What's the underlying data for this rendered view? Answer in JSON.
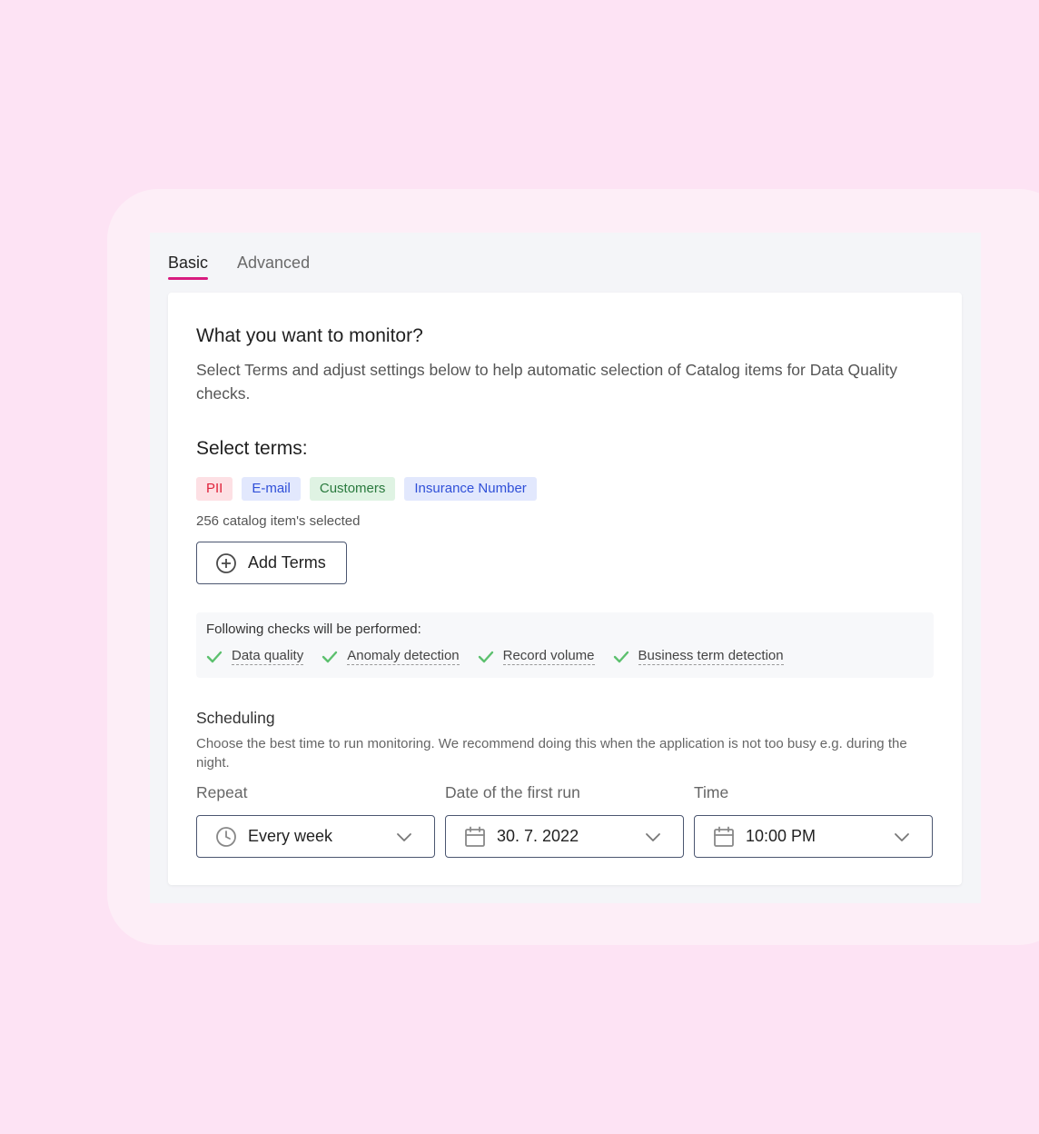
{
  "tabs": [
    {
      "label": "Basic",
      "active": true
    },
    {
      "label": "Advanced",
      "active": false
    }
  ],
  "monitor": {
    "title": "What you want to monitor?",
    "description": "Select Terms and adjust settings below to help automatic selection of Catalog items for Data Quality checks."
  },
  "terms": {
    "title": "Select terms:",
    "chips": [
      {
        "label": "PII",
        "color": "#e0233b"
      },
      {
        "label": "E-mail",
        "color": "#3050d8"
      },
      {
        "label": "Customers",
        "color": "#2a7a3e"
      },
      {
        "label": "Insurance Number",
        "color": "#3050d8"
      }
    ],
    "selected_count": "256 catalog item's selected",
    "add_button": "Add Terms"
  },
  "checks": {
    "title": "Following checks will be performed:",
    "items": [
      "Data quality",
      "Anomaly detection",
      "Record volume",
      "Business term detection"
    ]
  },
  "scheduling": {
    "title": "Scheduling",
    "description": "Choose the best time to run monitoring. We recommend doing this when the application is not too busy e.g. during the night.",
    "fields": [
      {
        "label": "Repeat",
        "value": "Every week",
        "icon": "clock-icon"
      },
      {
        "label": "Date of the first run",
        "value": "30. 7. 2022",
        "icon": "calendar-icon"
      },
      {
        "label": "Time",
        "value": "10:00 PM",
        "icon": "calendar-icon"
      }
    ]
  },
  "colors": {
    "accent": "#d81b7f",
    "check": "#5cc06e",
    "background": "#fde3f4"
  }
}
